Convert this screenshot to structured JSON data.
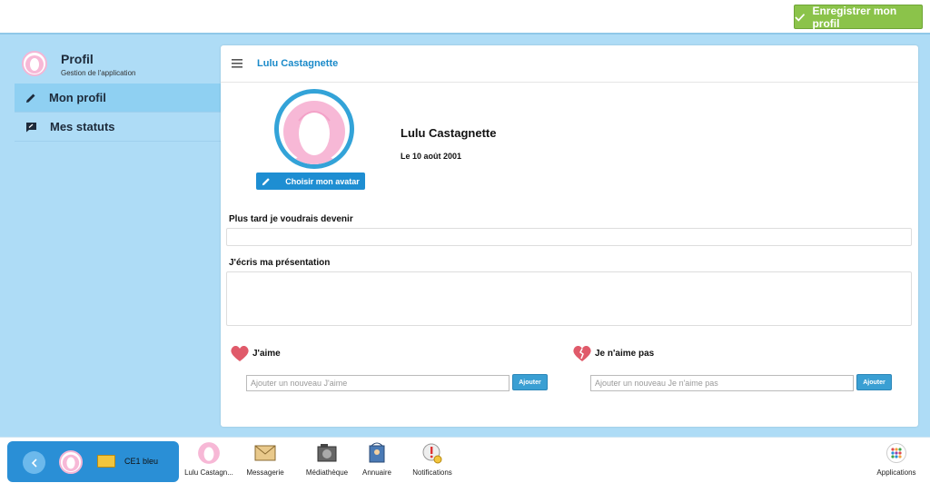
{
  "toolbar": {
    "save_label": "Enregistrer mon profil"
  },
  "sidebar": {
    "title": "Profil",
    "subtitle": "Gestion de l'application",
    "items": [
      {
        "label": "Mon profil",
        "icon": "pencil-icon",
        "active": true
      },
      {
        "label": "Mes statuts",
        "icon": "status-icon",
        "active": false
      }
    ]
  },
  "panel": {
    "title": "Lulu Castagnette",
    "avatar_button": "Choisir mon avatar",
    "user_name": "Lulu Castagnette",
    "birth_date": "Le 10 août 2001",
    "future_label": "Plus tard je voudrais devenir",
    "future_value": "",
    "presentation_label": "J'écris ma présentation",
    "presentation_value": "",
    "likes": {
      "title": "J'aime",
      "placeholder": "Ajouter un nouveau J'aime",
      "button": "Ajouter"
    },
    "dislikes": {
      "title": "Je n'aime pas",
      "placeholder": "Ajouter un nouveau Je n'aime pas",
      "button": "Ajouter"
    }
  },
  "taskbar": {
    "class_name": "CE1 bleu",
    "apps": [
      {
        "label": "Lulu Castagn...",
        "icon": "avatar-icon"
      },
      {
        "label": "Messagerie",
        "icon": "envelope-icon"
      },
      {
        "label": "Médiathèque",
        "icon": "media-icon"
      },
      {
        "label": "Annuaire",
        "icon": "directory-icon"
      },
      {
        "label": "Notifications",
        "icon": "notification-icon"
      }
    ],
    "applications_label": "Applications"
  },
  "colors": {
    "background": "#aedcf6",
    "accent": "#1e8ed2",
    "save_green": "#8bc34a",
    "sidebar_active": "#8fd0f2"
  }
}
